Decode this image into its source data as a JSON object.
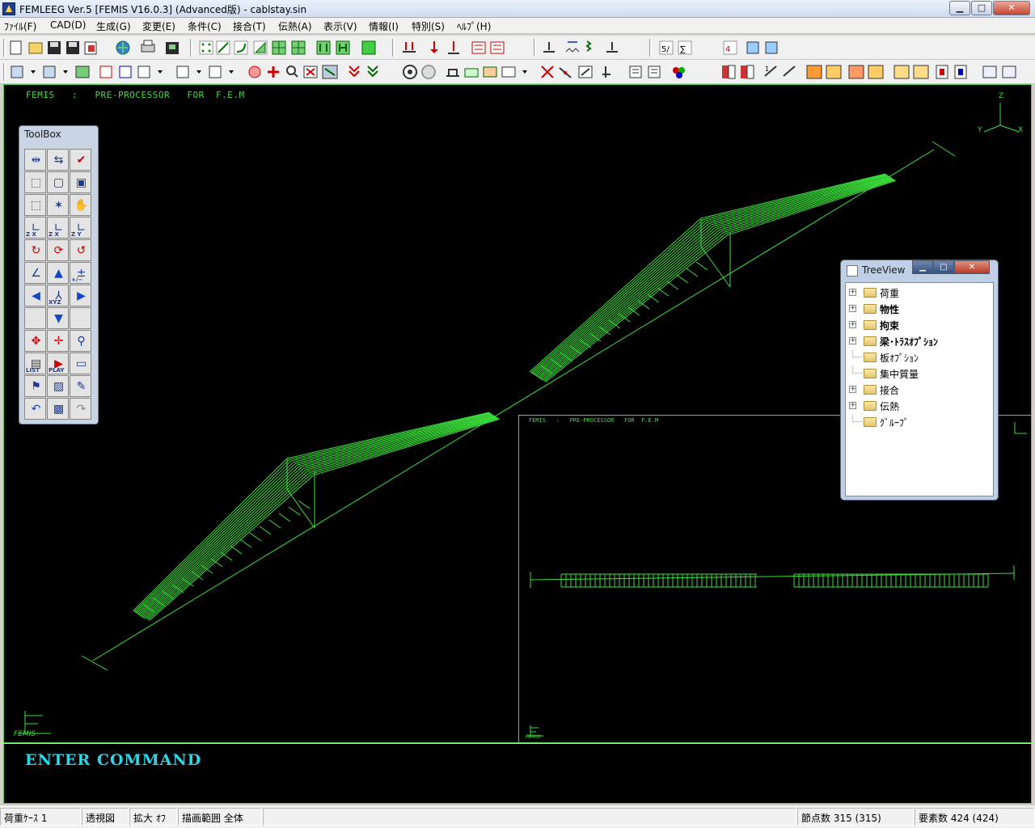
{
  "window": {
    "title": "FEMLEEG Ver.5 [FEMIS V16.0.3] (Advanced版) - cablstay.sin",
    "minimize": "▁",
    "maximize": "□",
    "close": "✕"
  },
  "menu": {
    "items": [
      "ﾌｧｲﾙ(F)",
      "CAD(D)",
      "生成(G)",
      "変更(E)",
      "条件(C)",
      "接合(T)",
      "伝熱(A)",
      "表示(V)",
      "情報(I)",
      "特別(S)",
      "ﾍﾙﾌﾟ(H)"
    ]
  },
  "viewport": {
    "header": "FEMIS   :   PRE-PROCESSOR   FOR  F.E.M",
    "line_color": "#3ce03c",
    "axis_labels": [
      "Z",
      "X",
      "Y"
    ],
    "logo": "FEMIS"
  },
  "subview": {
    "header": "FEMIS   :   PRE-PROCESSOR   FOR  F.E.M",
    "logo": "FEMIS"
  },
  "command": {
    "prompt": "ENTER COMMAND",
    "color": "#28d8e8"
  },
  "status": {
    "load_case": "荷重ｹｰｽ 1",
    "projection": "透視図",
    "zoom": "拡大 ｵﾌ",
    "draw_range": "描画範囲 全体",
    "nodes": "節点数 315 (315)",
    "elements": "要素数 424 (424)"
  },
  "toolbox": {
    "title": "ToolBox",
    "tools": [
      "mirror-icon",
      "swap-icon",
      "check-icon",
      "view-iso-icon",
      "view-front-icon",
      "view-shade-icon",
      "view-box-icon",
      "view-rotate-icon",
      "view-hand-icon",
      "axis-zx-icon",
      "axis-zx-2-icon",
      "axis-zy-icon",
      "rotate-x-icon",
      "rotate-z-icon",
      "rotate-y-icon",
      "angle-icon",
      "arrow-up-icon",
      "plus-minus-icon",
      "arrow-left-icon",
      "xyz-icon",
      "arrow-right-icon",
      "blank-icon",
      "arrow-down-icon",
      "blank-icon",
      "rotate-tool-icon",
      "move-tool-icon",
      "zoom-tool-icon",
      "list-icon",
      "play-icon",
      "eraser-icon",
      "flag-icon",
      "hatch-icon",
      "pen-icon",
      "undo-icon",
      "color-icon",
      "redo-icon"
    ],
    "labels": {
      "axis_zx": "Z X",
      "axis_zy": "Z Y",
      "plus_minus": "+/−",
      "xyz": "XYZ",
      "list": "LIST",
      "play": "PLAY"
    }
  },
  "treeview": {
    "title": "TreeView",
    "items": [
      {
        "label": "荷重",
        "expandable": true,
        "bold": false
      },
      {
        "label": "物性",
        "expandable": true,
        "bold": true
      },
      {
        "label": "拘束",
        "expandable": true,
        "bold": true
      },
      {
        "label": "梁･ﾄﾗｽｵﾌﾟｼｮﾝ",
        "expandable": true,
        "bold": true
      },
      {
        "label": "板ｵﾌﾟｼｮﾝ",
        "expandable": false,
        "bold": false
      },
      {
        "label": "集中質量",
        "expandable": false,
        "bold": false
      },
      {
        "label": "接合",
        "expandable": true,
        "bold": false
      },
      {
        "label": "伝熱",
        "expandable": true,
        "bold": false
      },
      {
        "label": "ｸﾞﾙｰﾌﾟ",
        "expandable": false,
        "bold": false
      }
    ]
  }
}
